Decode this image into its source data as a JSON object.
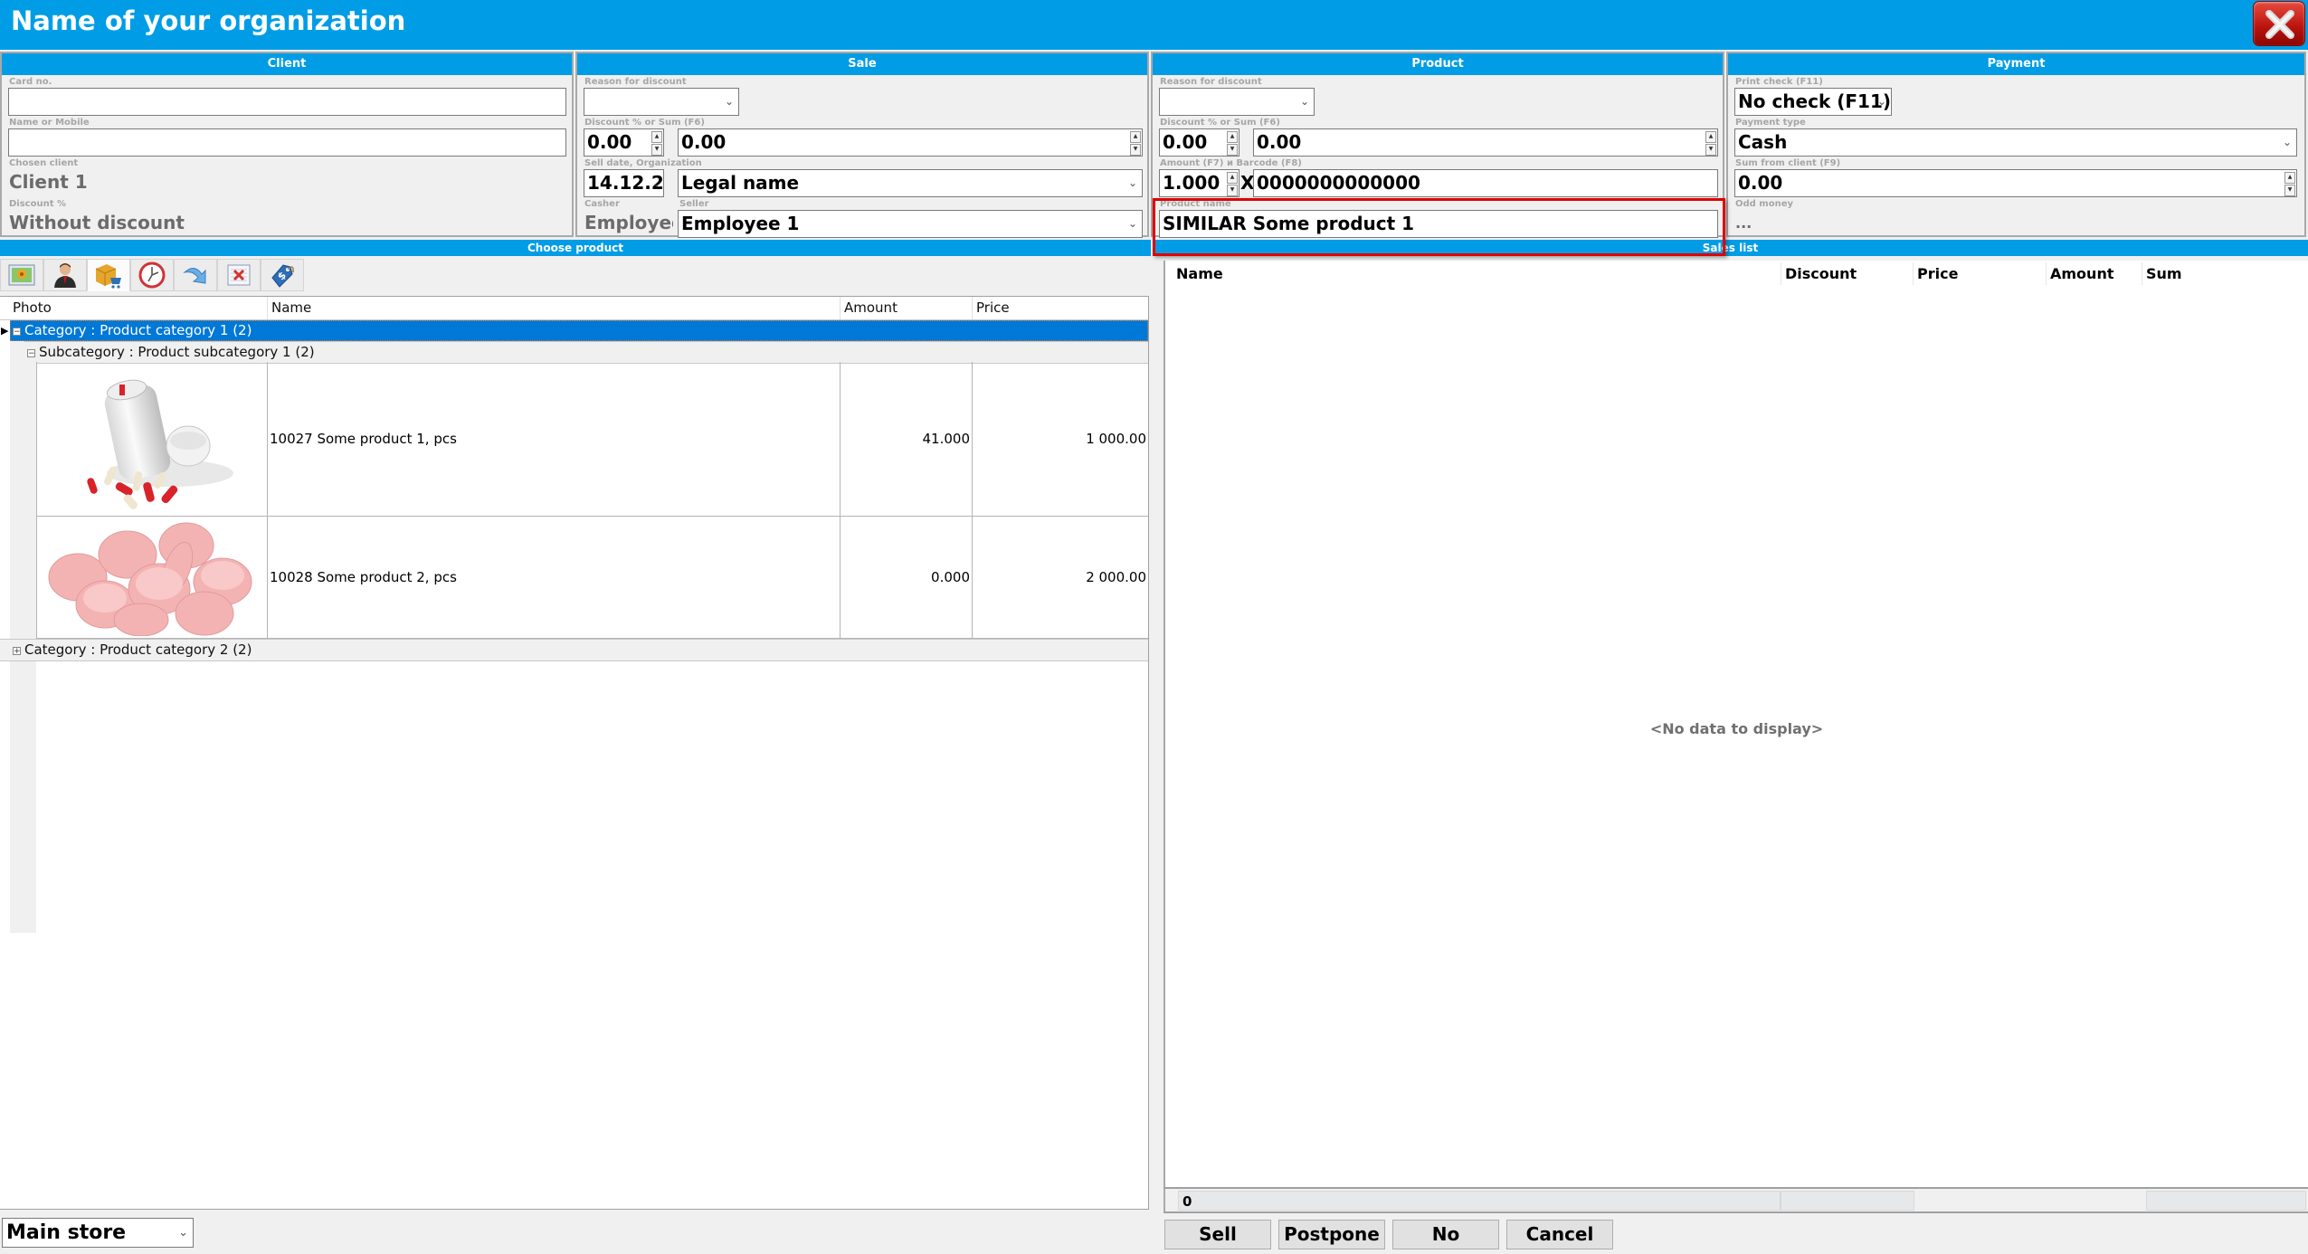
{
  "window": {
    "title": "Name of your organization",
    "close_icon": "close-icon"
  },
  "colors": {
    "accent": "#009de6",
    "selection": "#0078d7",
    "highlight_border": "#e00000",
    "close_button": "#c8170f"
  },
  "client": {
    "header": "Client",
    "card_label": "Card no.",
    "card_value": "",
    "name_label": "Name or Mobile",
    "name_value": "",
    "chosen_label": "Chosen client",
    "chosen_value": "Client 1",
    "discount_label": "Discount %",
    "discount_value": "Without discount"
  },
  "sale": {
    "header": "Sale",
    "reason_label": "Reason for discount",
    "reason_value": "",
    "discount_label": "Discount % or Sum (F6)",
    "discount_percent": "0.00",
    "discount_sum": "0.00",
    "date_org_label": "Sell date, Organization",
    "date_value": "14.12.2",
    "org_value": "Legal name",
    "casher_label": "Casher",
    "casher_value": "Employee",
    "seller_label": "Seller",
    "seller_value": "Employee 1"
  },
  "product": {
    "header": "Product",
    "reason_label": "Reason for discount",
    "reason_value": "",
    "discount_label": "Discount % or Sum (F6)",
    "discount_percent": "0.00",
    "discount_sum": "0.00",
    "amount_barcode_label": "Amount (F7) и Barcode (F8)",
    "amount_value": "1.000",
    "multiply_sign": "X",
    "barcode_value": "0000000000000",
    "name_label": "Product name",
    "name_value": "SIMILAR Some product 1"
  },
  "payment": {
    "header": "Payment",
    "print_label": "Print check (F11)",
    "print_value": "No check (F11)",
    "type_label": "Payment type",
    "type_value": "Cash",
    "sum_label": "Sum from client (F9)",
    "sum_value": "0.00",
    "odd_label": "Odd money",
    "odd_value": "..."
  },
  "choose_product": {
    "header": "Choose product",
    "toolbar": [
      {
        "icon": "photo-icon",
        "active": false
      },
      {
        "icon": "client-icon",
        "active": false
      },
      {
        "icon": "products-cart-icon",
        "active": true
      },
      {
        "icon": "clock-icon",
        "active": false
      },
      {
        "icon": "redo-arrow-icon",
        "active": false
      },
      {
        "icon": "delete-document-icon",
        "active": false
      },
      {
        "icon": "price-tag-icon",
        "active": false
      }
    ],
    "columns": [
      "Photo",
      "Name",
      "Amount",
      "Price"
    ],
    "category1": "Category : Product category 1 (2)",
    "subcategory1": "Subcategory : Product subcategory 1 (2)",
    "rows": [
      {
        "photo": "pill-bottle-image",
        "name": "10027 Some product 1, pcs",
        "amount": "41.000",
        "price": "1 000.00"
      },
      {
        "photo": "pink-tablets-image",
        "name": "10028 Some product 2, pcs",
        "amount": "0.000",
        "price": "2 000.00"
      }
    ],
    "category2": "Category : Product category 2 (2)"
  },
  "sales_list": {
    "header": "Sales list",
    "columns": [
      "Name",
      "Discount",
      "Price",
      "Amount",
      "Sum"
    ],
    "empty_text": "<No data to display>",
    "count": "0"
  },
  "footer": {
    "store_value": "Main store",
    "buttons": [
      "Sell",
      "Postpone",
      "No",
      "Cancel"
    ]
  }
}
